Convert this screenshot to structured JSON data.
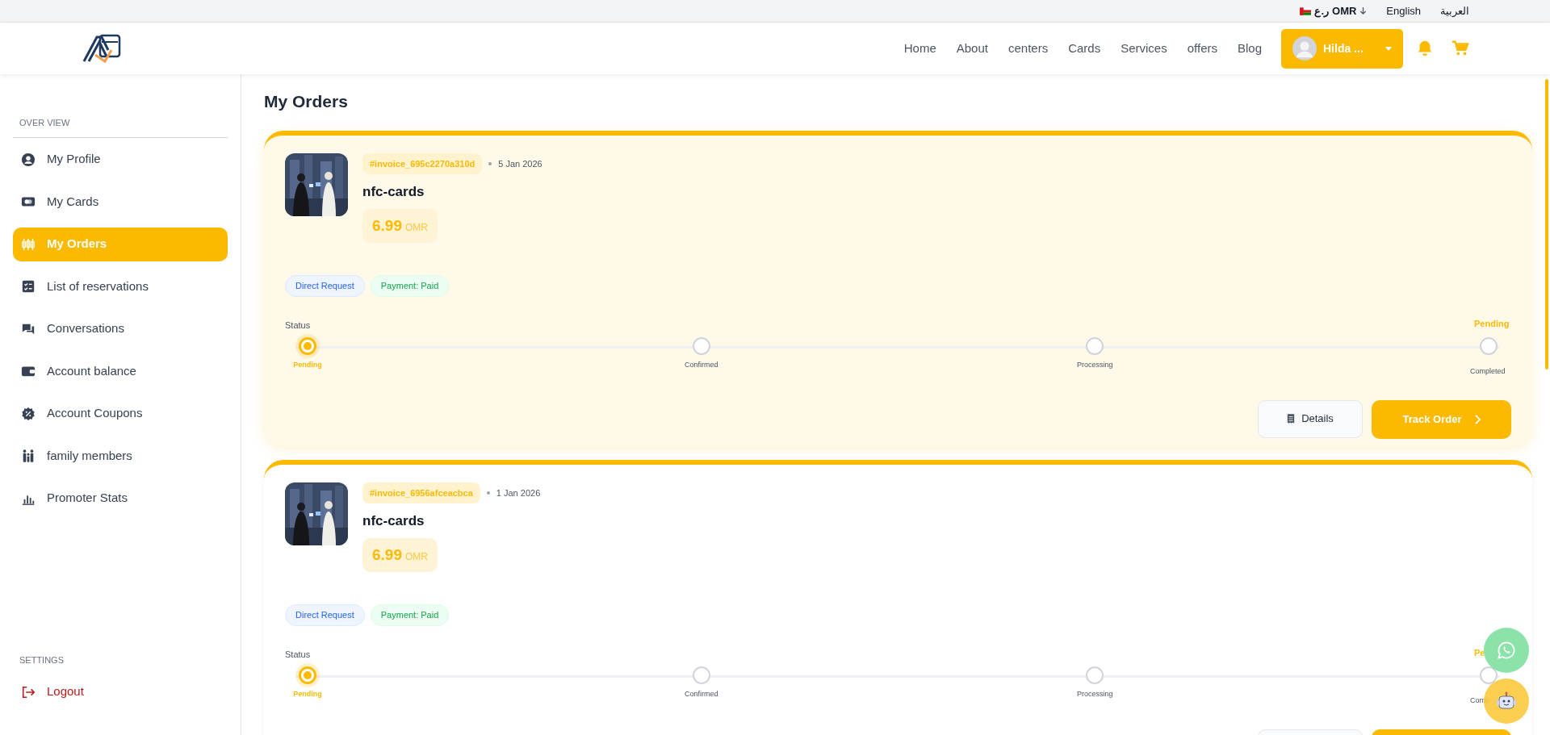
{
  "top_bar": {
    "currency_symbol": "ر.ع",
    "currency_code": "OMR",
    "languages": [
      {
        "label": "English"
      },
      {
        "label": "العربية"
      }
    ]
  },
  "header": {
    "nav": [
      "Home",
      "About",
      "centers",
      "Cards",
      "Services",
      "offers",
      "Blog"
    ],
    "user": {
      "name": "Hilda ..."
    }
  },
  "sidebar": {
    "sections": [
      {
        "title": "OVER VIEW",
        "items": [
          {
            "label": "My Profile",
            "kind": "profile",
            "selected": false
          },
          {
            "label": "My Cards",
            "kind": "cards",
            "selected": false
          },
          {
            "label": "My Orders",
            "kind": "orders",
            "selected": true
          },
          {
            "label": "List of reservations",
            "kind": "reservations",
            "selected": false
          },
          {
            "label": "Conversations",
            "kind": "conversations",
            "selected": false
          },
          {
            "label": "Account balance",
            "kind": "balance",
            "selected": false
          },
          {
            "label": "Account Coupons",
            "kind": "coupons",
            "selected": false
          },
          {
            "label": "family members",
            "kind": "family",
            "selected": false
          },
          {
            "label": "Promoter Stats",
            "kind": "stats",
            "selected": false
          }
        ]
      },
      {
        "title": "SETTINGS",
        "items": [
          {
            "label": "Logout",
            "kind": "logout",
            "selected": false
          }
        ]
      }
    ]
  },
  "page_title": "My Orders",
  "orders": [
    {
      "highlighted": true,
      "invoice": "#invoice_695c2270a310d",
      "date": "5 Jan 2026",
      "product": "nfc-cards",
      "price": "6.99",
      "currency": "OMR",
      "tags": [
        {
          "label": "Direct Request",
          "kind": "request"
        },
        {
          "label": "Payment: Paid",
          "kind": "payment"
        }
      ],
      "status_label": "Status",
      "current_status": "Pending",
      "steps": [
        {
          "label": "Pending",
          "active": true
        },
        {
          "label": "Confirmed",
          "active": false
        },
        {
          "label": "Processing",
          "active": false
        },
        {
          "label": "Completed",
          "active": false
        }
      ],
      "buttons": [
        {
          "label": "Details",
          "kind": "details"
        },
        {
          "label": "Track Order",
          "kind": "track"
        }
      ]
    },
    {
      "highlighted": false,
      "invoice": "#invoice_6956afceacbca",
      "date": "1 Jan 2026",
      "product": "nfc-cards",
      "price": "6.99",
      "currency": "OMR",
      "tags": [
        {
          "label": "Direct Request",
          "kind": "request"
        },
        {
          "label": "Payment: Paid",
          "kind": "payment"
        }
      ],
      "status_label": "Status",
      "current_status": "Pe",
      "steps": [
        {
          "label": "Pending",
          "active": true
        },
        {
          "label": "Confirmed",
          "active": false
        },
        {
          "label": "Processing",
          "active": false
        },
        {
          "label": "Comp",
          "active": false
        }
      ],
      "buttons": [
        {
          "kind": "details"
        },
        {
          "kind": "track"
        }
      ]
    }
  ]
}
